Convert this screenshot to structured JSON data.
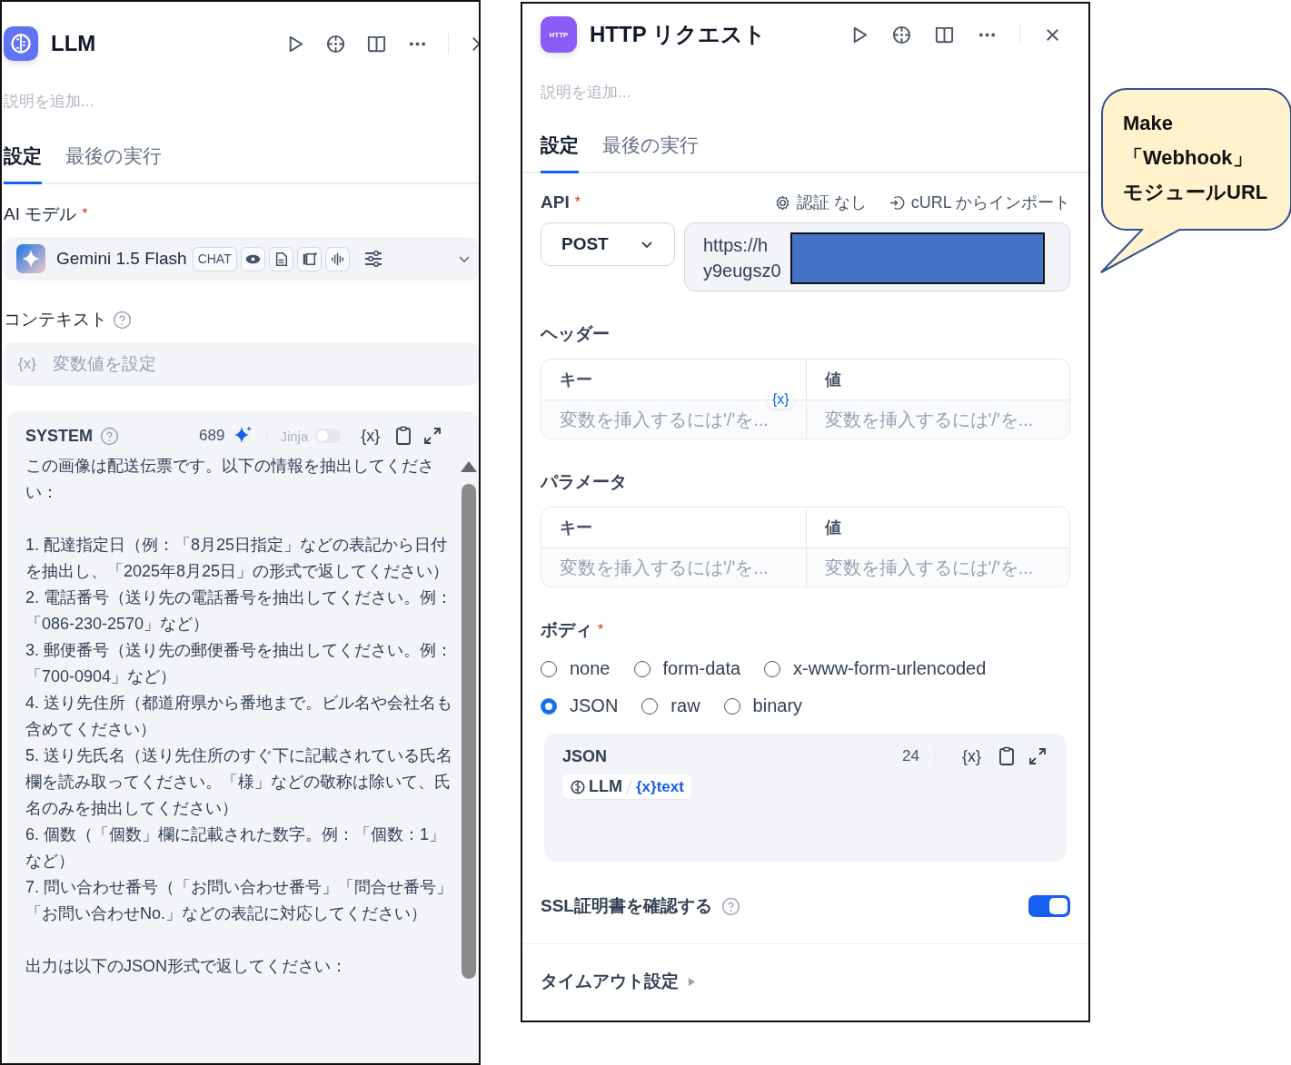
{
  "llm_panel": {
    "title": "LLM",
    "description_placeholder": "説明を追加...",
    "tabs": [
      {
        "label": "設定",
        "selected": true
      },
      {
        "label": "最後の実行",
        "selected": false
      }
    ],
    "model": {
      "label": "AI モデル",
      "required_mark": "*",
      "name": "Gemini 1.5 Flash",
      "badge": "CHAT"
    },
    "context": {
      "label": "コンテキスト",
      "var_glyph": "{x}",
      "placeholder": "変数値を設定"
    },
    "system": {
      "label": "SYSTEM",
      "count": "689",
      "jinja_label": "Jinja",
      "jinja_on": false,
      "var_glyph": "{x}",
      "blocks": [
        [
          "この画像は配送伝票です。以下の情報を抽出してください："
        ],
        [
          "1. 配達指定日（例：「8月25日指定」などの表記から日付を抽出し、「2025年8月25日」の形式で返してください）",
          "2. 電話番号（送り先の電話番号を抽出してください。例：「086-230-2570」など）",
          "3. 郵便番号（送り先の郵便番号を抽出してください。例：「700-0904」など）",
          "4. 送り先住所（都道府県から番地まで。ビル名や会社名も含めてください）",
          "5. 送り先氏名（送り先住所のすぐ下に記載されている氏名欄を読み取ってください。「様」などの敬称は除いて、氏名のみを抽出してください）",
          "6. 個数（「個数」欄に記載された数字。例：「個数：1」など）",
          "7. 問い合わせ番号（「お問い合わせ番号」「問合せ番号」「お問い合わせNo.」などの表記に対応してください）"
        ],
        [
          "出力は以下のJSON形式で返してください："
        ]
      ]
    }
  },
  "http_panel": {
    "icon_label": "HTTP",
    "title": "HTTP リクエスト",
    "description_placeholder": "説明を追加...",
    "tabs": [
      {
        "label": "設定",
        "selected": true
      },
      {
        "label": "最後の実行",
        "selected": false
      }
    ],
    "api": {
      "label": "API",
      "required_mark": "*",
      "auth_label": "認証",
      "auth_value": "なし",
      "import_label": "cURL からインポート",
      "method": "POST",
      "url_lines": [
        "https://h",
        "y9eugsz0"
      ]
    },
    "headers": {
      "label": "ヘッダー",
      "columns": [
        "キー",
        "値"
      ],
      "placeholders": [
        "変数を挿入するには'/'を...",
        "変数を挿入するには'/'を..."
      ],
      "var_glyph": "{x}"
    },
    "params": {
      "label": "パラメータ",
      "columns": [
        "キー",
        "値"
      ],
      "placeholders": [
        "変数を挿入するには'/'を...",
        "変数を挿入するには'/'を..."
      ]
    },
    "body": {
      "label": "ボディ",
      "required_mark": "*",
      "option_rows": [
        [
          {
            "label": "none",
            "selected": false
          },
          {
            "label": "form-data",
            "selected": false
          },
          {
            "label": "x-www-form-urlencoded",
            "selected": false
          }
        ],
        [
          {
            "label": "JSON",
            "selected": true
          },
          {
            "label": "raw",
            "selected": false
          },
          {
            "label": "binary",
            "selected": false
          }
        ]
      ],
      "editor": {
        "label": "JSON",
        "count": "24",
        "var_glyph": "{x}",
        "node": "LLM",
        "variable_glyph": "{x}",
        "variable": "text"
      }
    },
    "ssl": {
      "label": "SSL証明書を確認する",
      "on": true
    },
    "timeout": {
      "label": "タイムアウト設定"
    }
  },
  "callout": {
    "lines": [
      "Make",
      "「Webhook」",
      "モジュールURL"
    ]
  }
}
